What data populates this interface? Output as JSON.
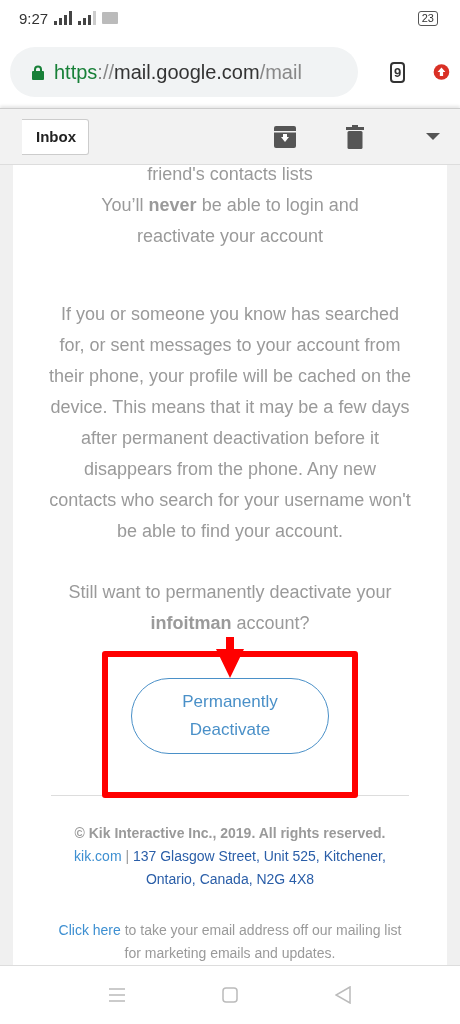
{
  "status_bar": {
    "time": "9:27",
    "battery": "23"
  },
  "browser": {
    "url": {
      "scheme": "https",
      "separator": "://",
      "host": "mail.google.com",
      "path": "/mail"
    },
    "tab_count": "9"
  },
  "toolbar": {
    "back_label": "Inbox"
  },
  "email": {
    "top_lines": [
      "friend's contacts lists",
      "You’ll **never** be able to login and reactivate your account"
    ],
    "paragraph": "If you or someone you know has searched for, or sent messages to your account from their phone, your profile will be cached on the device. This means that it may be a few days after permanent deactivation before it disappears from the phone. Any new contacts who search for your username won't be able to find your account.",
    "question": "Still want to permanently deactivate your **infoitman** account?",
    "button": "Permanently Deactivate",
    "copyright": "© Kik Interactive Inc., 2019. All rights reserved.",
    "site_link": "kik.com",
    "separator": "|",
    "address": "137 Glasgow Street, Unit 525, Kitchener, Ontario, Canada, N2G 4X8",
    "unsubscribe_link": "Click here",
    "unsubscribe_text": "to take your email address off our mailing list for marketing emails and updates."
  },
  "annotations": {
    "arrow": {
      "color": "#ff0000"
    },
    "highlight_frame": {
      "color": "#ff0000"
    }
  }
}
